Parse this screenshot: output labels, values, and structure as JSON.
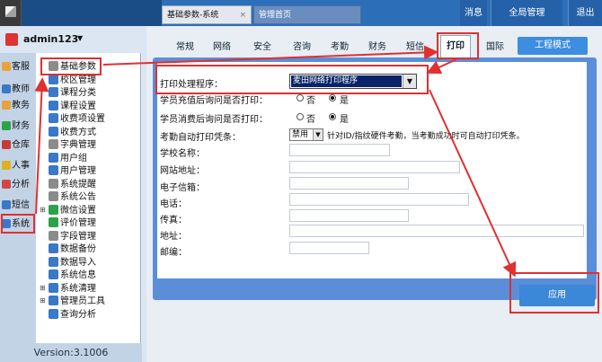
{
  "topbar": {
    "tabs": [
      {
        "label": "基础参数-系统",
        "close": "×"
      },
      {
        "label": "管理首页"
      }
    ],
    "buttons": {
      "message": "消息",
      "global": "全局管理",
      "exit": "退出"
    }
  },
  "user": {
    "name": "admin123",
    "caret": "▼"
  },
  "leftnav": {
    "items": [
      {
        "label": "客服",
        "color": "#e9a23b"
      },
      {
        "label": "教师",
        "color": "#3a78c8"
      },
      {
        "label": "教务",
        "color": "#e9a23b"
      },
      {
        "label": "财务",
        "color": "#2aa34a"
      },
      {
        "label": "仓库",
        "color": "#c83a3a"
      },
      {
        "label": "人事",
        "color": "#e0b020"
      },
      {
        "label": "分析",
        "color": "#d34545"
      },
      {
        "label": "短信",
        "color": "#3a78c8"
      },
      {
        "label": "系统",
        "color": "#3a78c8"
      }
    ]
  },
  "tree": {
    "items": [
      {
        "label": "基础参数",
        "color": "#8b8b8b"
      },
      {
        "label": "校区管理",
        "color": "#3a78c8"
      },
      {
        "label": "课程分类",
        "color": "#3a78c8"
      },
      {
        "label": "课程设置",
        "color": "#3a78c8"
      },
      {
        "label": "收费项设置",
        "color": "#3a78c8"
      },
      {
        "label": "收费方式",
        "color": "#3a78c8"
      },
      {
        "label": "字典管理",
        "color": "#8b8b8b"
      },
      {
        "label": "用户组",
        "color": "#3a78c8"
      },
      {
        "label": "用户管理",
        "color": "#3a78c8"
      },
      {
        "label": "系统提醒",
        "color": "#8b8b8b"
      },
      {
        "label": "系统公告",
        "color": "#8b8b8b"
      },
      {
        "label": "微信设置",
        "color": "#2aa34a"
      },
      {
        "label": "评价管理",
        "color": "#2aa34a"
      },
      {
        "label": "字段管理",
        "color": "#8b8b8b"
      },
      {
        "label": "数据备份",
        "color": "#3a78c8"
      },
      {
        "label": "数据导入",
        "color": "#3a78c8"
      },
      {
        "label": "系统信息",
        "color": "#3a78c8"
      },
      {
        "label": "系统清理",
        "color": "#3a78c8"
      },
      {
        "label": "管理员工具",
        "color": "#3a78c8"
      },
      {
        "label": "查询分析",
        "color": "#3a78c8"
      }
    ],
    "plus": "⊞"
  },
  "version": "Version:3.1006",
  "settings_tabs": [
    "常规",
    "网络",
    "安全",
    "咨询",
    "考勤",
    "财务",
    "短信",
    "打印",
    "国际"
  ],
  "mode_button": "工程模式",
  "form": {
    "print_program_label": "打印处理程序：",
    "print_program_value": "麦田网络打印程序",
    "recharge_label": "学员充值后询问是否打印：",
    "consume_label": "学员消费后询问是否打印：",
    "radio_no": "否",
    "radio_yes": "是",
    "attendance_label": "考勤自动打印凭条：",
    "attendance_value": "禁用",
    "attendance_hint": "针对ID/指纹硬件考勤，当考勤成功时可自动打印凭条。",
    "school_name_label": "学校名称：",
    "website_label": "网站地址：",
    "email_label": "电子信箱：",
    "phone_label": "电话：",
    "fax_label": "传真：",
    "address_label": "地址：",
    "zip_label": "邮编："
  },
  "apply_button": "应用",
  "colors": {
    "topbar": "#2c6fb8",
    "accent": "#3b87d8",
    "highlight": "#e03030"
  }
}
